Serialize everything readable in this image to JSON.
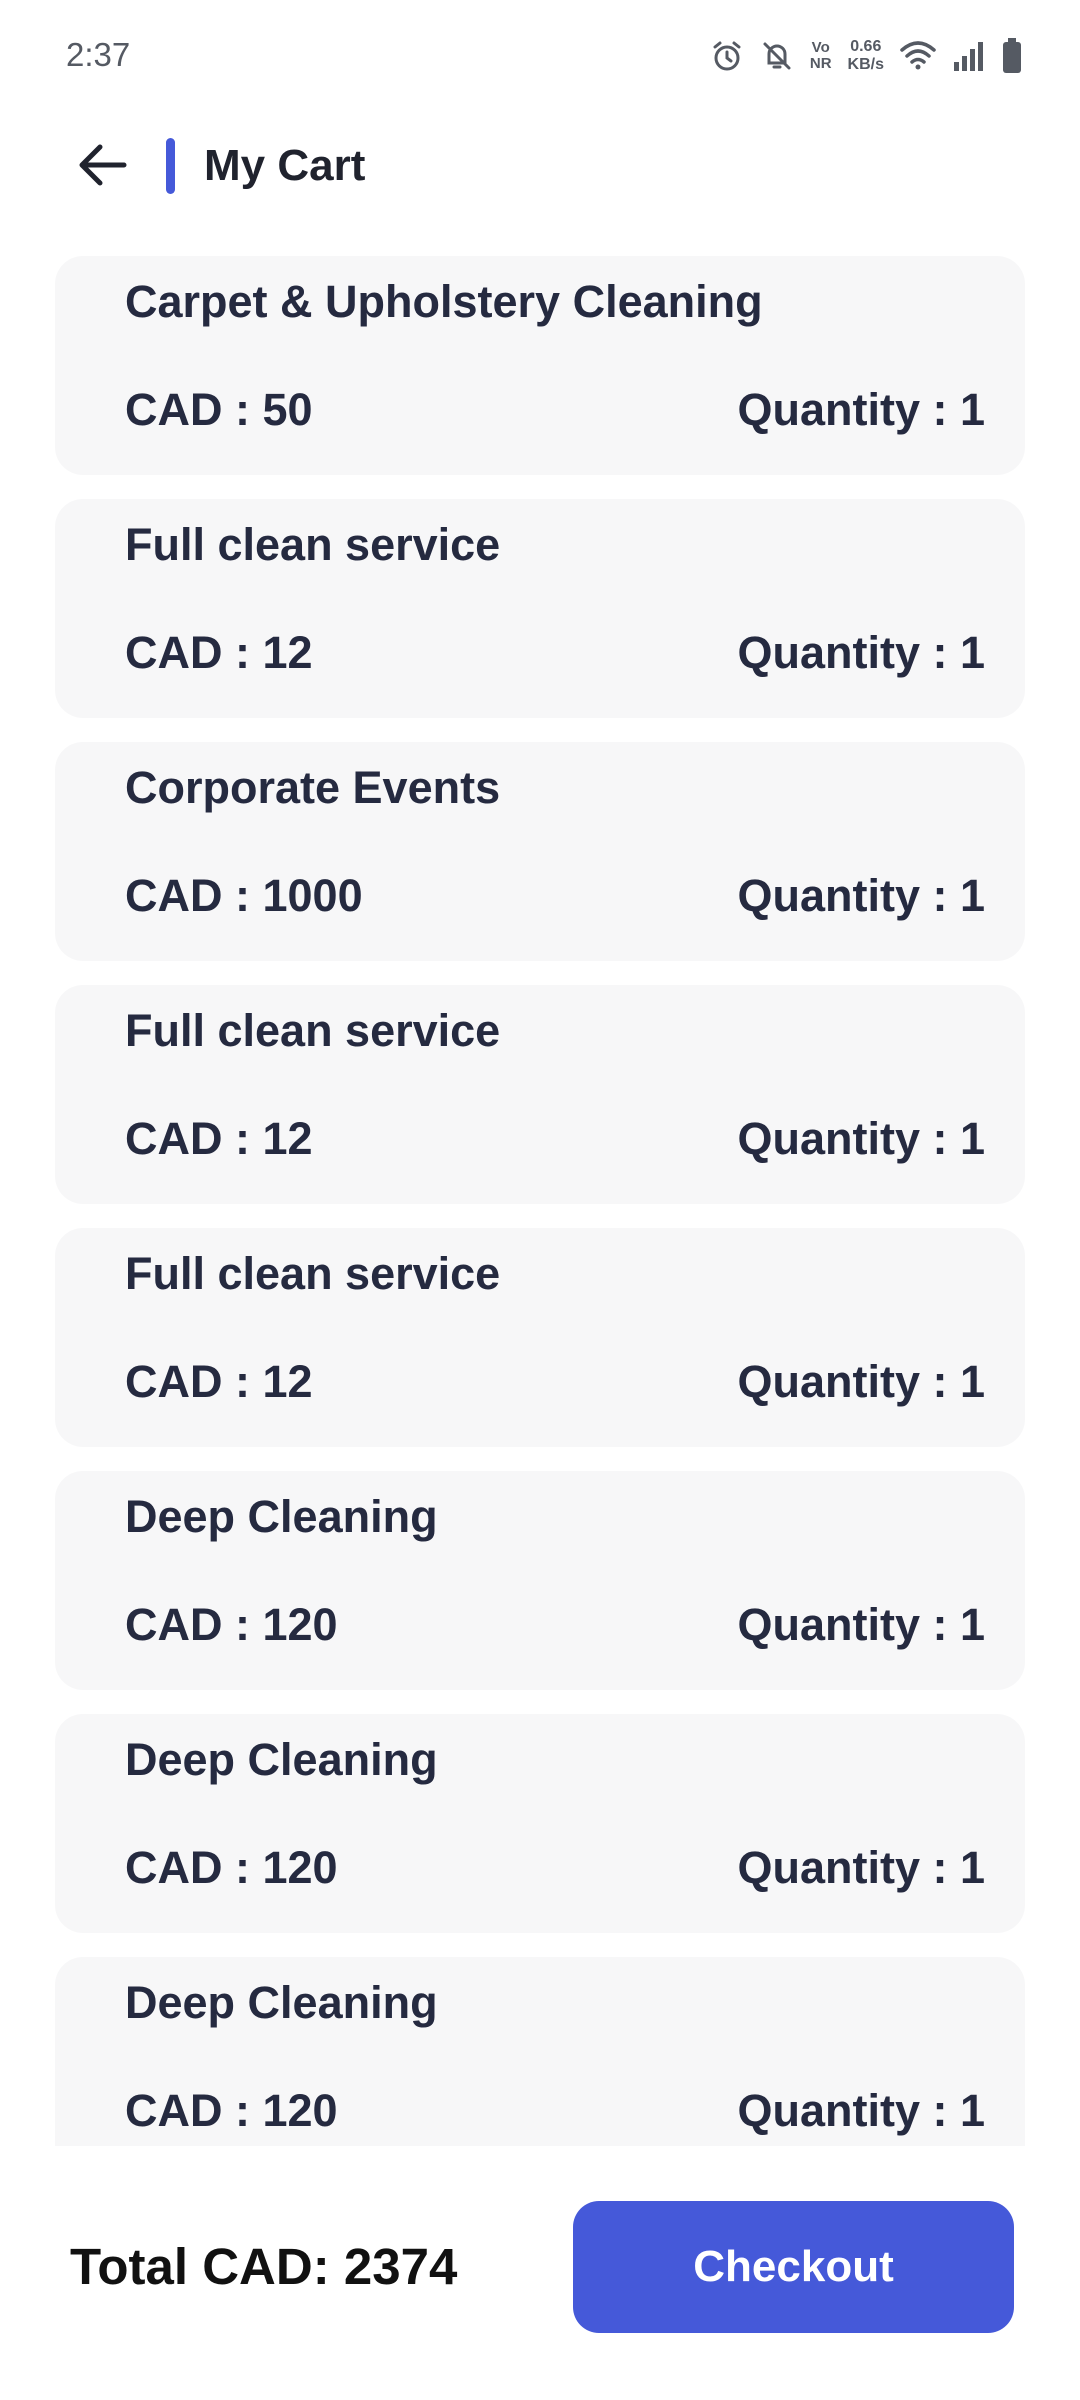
{
  "status_bar": {
    "time": "2:37",
    "net_speed_value": "0.66",
    "net_speed_unit": "KB/s",
    "vonr_top": "Vo",
    "vonr_bottom": "NR",
    "icons": [
      "alarm-icon",
      "bell-off-icon",
      "vonr-icon",
      "wifi-icon",
      "signal-icon",
      "battery-icon"
    ]
  },
  "header": {
    "title": "My Cart",
    "back_icon": "arrow-left-icon",
    "accent_color": "#4559d9"
  },
  "cart": {
    "price_prefix": "CAD : ",
    "quantity_prefix": "Quantity : ",
    "items": [
      {
        "name": "Carpet & Upholstery Cleaning",
        "price": "CAD : 50",
        "quantity": "Quantity : 1"
      },
      {
        "name": "Full clean service",
        "price": "CAD : 12",
        "quantity": "Quantity : 1"
      },
      {
        "name": "Corporate Events",
        "price": "CAD : 1000",
        "quantity": "Quantity : 1"
      },
      {
        "name": "Full clean service",
        "price": "CAD : 12",
        "quantity": "Quantity : 1"
      },
      {
        "name": "Full clean service",
        "price": "CAD : 12",
        "quantity": "Quantity : 1"
      },
      {
        "name": "Deep Cleaning",
        "price": "CAD : 120",
        "quantity": "Quantity : 1"
      },
      {
        "name": "Deep Cleaning",
        "price": "CAD : 120",
        "quantity": "Quantity : 1"
      },
      {
        "name": "Deep Cleaning",
        "price": "CAD : 120",
        "quantity": "Quantity : 1"
      }
    ]
  },
  "footer": {
    "total_label": "Total CAD: 2374",
    "checkout_label": "Checkout",
    "button_color": "#4559d9"
  }
}
